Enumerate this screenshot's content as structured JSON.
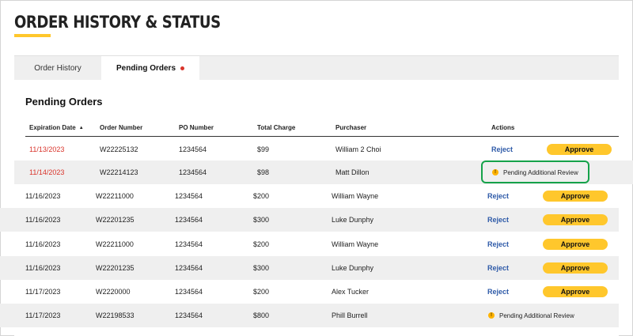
{
  "page": {
    "title": "ORDER HISTORY & STATUS"
  },
  "tabs": [
    {
      "label": "Order History",
      "active": false
    },
    {
      "label": "Pending Orders",
      "active": true,
      "indicator": "red-dot"
    }
  ],
  "section": {
    "title": "Pending Orders"
  },
  "table": {
    "headers": {
      "expiration": "Expiration Date",
      "order": "Order Number",
      "po": "PO Number",
      "charge": "Total Charge",
      "purchaser": "Purchaser",
      "actions": "Actions"
    },
    "sort_indicator": "▲",
    "rows": [
      {
        "expiration": "11/13/2023",
        "order": "W22225132",
        "po": "1234564",
        "charge": "$99",
        "purchaser": "William 2 Choi",
        "reject": "Reject",
        "approve": "Approve"
      },
      {
        "expiration": "11/14/2023",
        "order": "W22214123",
        "po": "1234564",
        "charge": "$98",
        "purchaser": "Matt Dillon",
        "status": "Pending Additional Review"
      },
      {
        "expiration": "11/16/2023",
        "order": "W22211000",
        "po": "1234564",
        "charge": "$200",
        "purchaser": "William Wayne",
        "reject": "Reject",
        "approve": "Approve"
      },
      {
        "expiration": "11/16/2023",
        "order": "W22201235",
        "po": "1234564",
        "charge": "$300",
        "purchaser": "Luke Dunphy",
        "reject": "Reject",
        "approve": "Approve"
      },
      {
        "expiration": "11/16/2023",
        "order": "W22211000",
        "po": "1234564",
        "charge": "$200",
        "purchaser": "William Wayne",
        "reject": "Reject",
        "approve": "Approve"
      },
      {
        "expiration": "11/16/2023",
        "order": "W22201235",
        "po": "1234564",
        "charge": "$300",
        "purchaser": "Luke Dunphy",
        "reject": "Reject",
        "approve": "Approve"
      },
      {
        "expiration": "11/17/2023",
        "order": "W2220000",
        "po": "1234564",
        "charge": "$200",
        "purchaser": "Alex Tucker",
        "reject": "Reject",
        "approve": "Approve"
      },
      {
        "expiration": "11/17/2023",
        "order": "W22198533",
        "po": "1234564",
        "charge": "$800",
        "purchaser": "Phill Burrell",
        "status": "Pending Additional Review"
      }
    ]
  },
  "colors": {
    "accent": "#ffc72c",
    "expired_date": "#d9342b",
    "link": "#2e5aa8",
    "highlight_outline": "#15a24a"
  }
}
